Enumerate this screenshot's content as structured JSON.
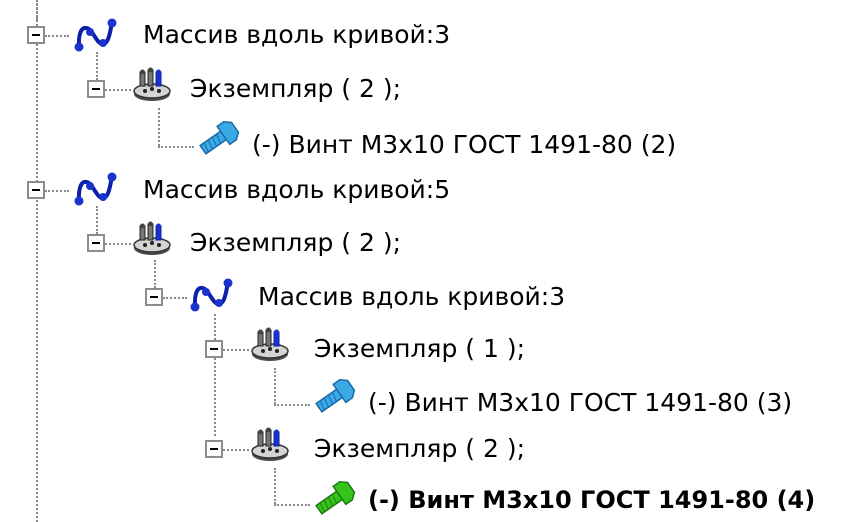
{
  "tree": {
    "nodes": [
      {
        "label": "Массив вдоль кривой:3",
        "icon": "curve-array-icon"
      },
      {
        "label": "Экземпляр ( 2 );",
        "icon": "instance-icon"
      },
      {
        "label": "(-) Винт М3х10 ГОСТ 1491-80 (2)",
        "icon": "screw-icon"
      },
      {
        "label": "Массив вдоль кривой:5",
        "icon": "curve-array-icon"
      },
      {
        "label": "Экземпляр ( 2 );",
        "icon": "instance-icon"
      },
      {
        "label": "Массив вдоль кривой:3",
        "icon": "curve-array-icon"
      },
      {
        "label": "Экземпляр ( 1 );",
        "icon": "instance-icon"
      },
      {
        "label": "(-) Винт М3х10 ГОСТ 1491-80 (3)",
        "icon": "screw-icon"
      },
      {
        "label": "Экземпляр ( 2 );",
        "icon": "instance-icon"
      },
      {
        "label": "(-) Винт М3х10 ГОСТ 1491-80 (4)",
        "icon": "screw-icon-selected",
        "selected": true
      }
    ]
  },
  "colors": {
    "screw": "#3aa9e6",
    "screw_selected": "#35c41a",
    "curve_nodes": "#1a33cc"
  }
}
